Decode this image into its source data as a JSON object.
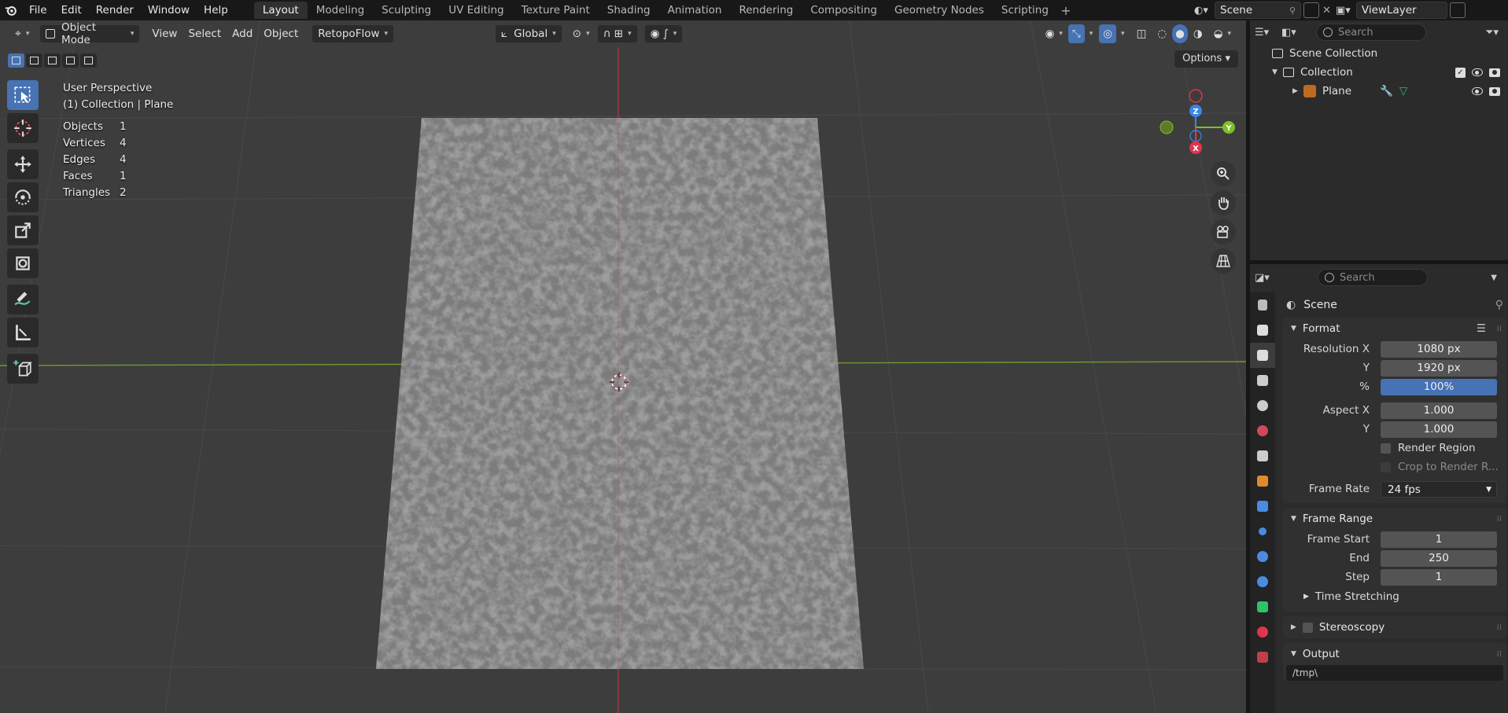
{
  "topbar": {
    "menus": [
      "File",
      "Edit",
      "Render",
      "Window",
      "Help"
    ],
    "workspaces": [
      "Layout",
      "Modeling",
      "Sculpting",
      "UV Editing",
      "Texture Paint",
      "Shading",
      "Animation",
      "Rendering",
      "Compositing",
      "Geometry Nodes",
      "Scripting"
    ],
    "active_workspace": "Layout",
    "scene": "Scene",
    "view_layer": "ViewLayer"
  },
  "viewport_header": {
    "mode": "Object Mode",
    "menus": [
      "View",
      "Select",
      "Add",
      "Object"
    ],
    "addon": "RetopoFlow",
    "orientation": "Global"
  },
  "overlay": {
    "view_name": "User Perspective",
    "collection_info": "(1) Collection | Plane",
    "stats": [
      {
        "label": "Objects",
        "value": "1"
      },
      {
        "label": "Vertices",
        "value": "4"
      },
      {
        "label": "Edges",
        "value": "4"
      },
      {
        "label": "Faces",
        "value": "1"
      },
      {
        "label": "Triangles",
        "value": "2"
      }
    ],
    "options_label": "Options"
  },
  "gizmo": {
    "x": "X",
    "y": "Y",
    "z": "Z"
  },
  "outliner": {
    "search_placeholder": "Search",
    "scene_collection": "Scene Collection",
    "collection": "Collection",
    "object": "Plane"
  },
  "properties": {
    "search_placeholder": "Search",
    "context": "Scene",
    "format": {
      "title": "Format",
      "res_x_label": "Resolution X",
      "res_x": "1080 px",
      "res_y_label": "Y",
      "res_y": "1920 px",
      "pct_label": "%",
      "pct": "100%",
      "aspect_x_label": "Aspect X",
      "aspect_x": "1.000",
      "aspect_y_label": "Y",
      "aspect_y": "1.000",
      "render_region": "Render Region",
      "crop": "Crop to Render R...",
      "frame_rate_label": "Frame Rate",
      "frame_rate": "24 fps"
    },
    "frame_range": {
      "title": "Frame Range",
      "start_label": "Frame Start",
      "start": "1",
      "end_label": "End",
      "end": "250",
      "step_label": "Step",
      "step": "1",
      "time_stretching": "Time Stretching"
    },
    "stereoscopy": "Stereoscopy",
    "output": {
      "title": "Output",
      "path": "/tmp\\"
    }
  },
  "colors": {
    "accent": "#4772b3",
    "axis_x": "#e0344f",
    "axis_y": "#7fbf2a",
    "axis_z": "#3a86e6"
  }
}
